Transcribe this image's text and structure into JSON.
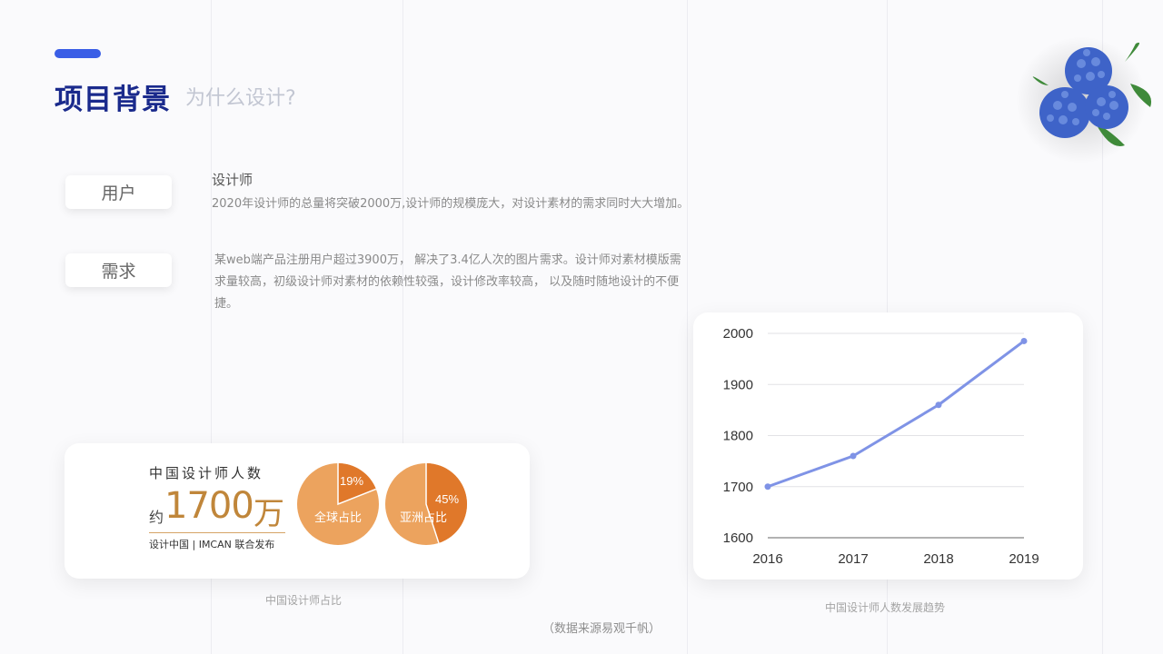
{
  "header": {
    "title": "项目背景",
    "subtitle": "为什么设计?"
  },
  "tags": [
    {
      "label": "用户"
    },
    {
      "label": "需求"
    }
  ],
  "user_section": {
    "heading": "设计师",
    "text": "2020年设计师的总量将突破2000万,设计师的规模庞大，对设计素材的需求同时大大增加。"
  },
  "demand_section": {
    "lines": [
      "某web端产品注册用户超过3900万， 解决了3.4亿人次的图片需求。设计师对素材模版需",
      "求量较高，初级设计师对素材的依赖性较强，设计修改率较高， 以及随时随地设计的不便",
      "捷。"
    ]
  },
  "stat_card": {
    "heading": "中国设计师人数",
    "prefix": "约",
    "number": "1700",
    "unit": "万",
    "publisher": "设计中国 | IMCAN 联合发布",
    "pies": [
      {
        "percent": 19,
        "percent_label": "19%",
        "label": "全球占比"
      },
      {
        "percent": 45,
        "percent_label": "45%",
        "label": "亚洲占比"
      }
    ],
    "caption": "中国设计师占比"
  },
  "chart_data": {
    "type": "line",
    "x": [
      "2016",
      "2017",
      "2018",
      "2019"
    ],
    "series": [
      {
        "values": [
          1700,
          1760,
          1860,
          1985
        ]
      }
    ],
    "ylim": [
      1600,
      2000
    ],
    "yticks": [
      "1600",
      "1700",
      "1800",
      "1900",
      "2000"
    ],
    "grid": true,
    "color": "#7f93e6"
  },
  "chart_caption": "中国设计师人数发展趋势",
  "source_note": "（数据来源易观千帆）",
  "colors": {
    "accent": "#3a5ee6",
    "title": "#1a2a8c",
    "pie_dark": "#e0782a",
    "pie_light": "#eca35e"
  },
  "decor": {
    "flower_icon": "hydrangea-flower-icon"
  }
}
